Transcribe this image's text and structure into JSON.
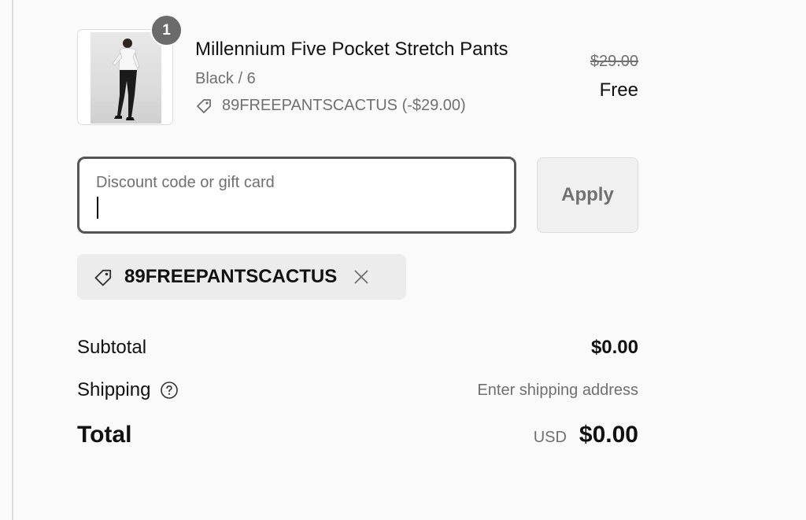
{
  "product": {
    "quantity": "1",
    "name": "Millennium Five Pocket Stretch Pants",
    "variant": "Black / 6",
    "discount_line": "89FREEPANTSCACTUS (-$29.00)",
    "price_original": "$29.00",
    "price_final": "Free",
    "thumbnail_icon": "product-photo"
  },
  "discount": {
    "label": "Discount code or gift card",
    "value": "",
    "apply_label": "Apply"
  },
  "applied_code": {
    "code": "89FREEPANTSCACTUS",
    "icon": "tag-icon",
    "remove_icon": "close-icon"
  },
  "totals": {
    "subtotal_label": "Subtotal",
    "subtotal_value": "$0.00",
    "shipping_label": "Shipping",
    "shipping_value": "Enter shipping address",
    "total_label": "Total",
    "currency": "USD",
    "total_value": "$0.00"
  },
  "colors": {
    "background": "#fafafa",
    "muted_text": "#707070",
    "field_border": "#555555",
    "badge": "#6b6b6b",
    "chip": "#ececec"
  }
}
